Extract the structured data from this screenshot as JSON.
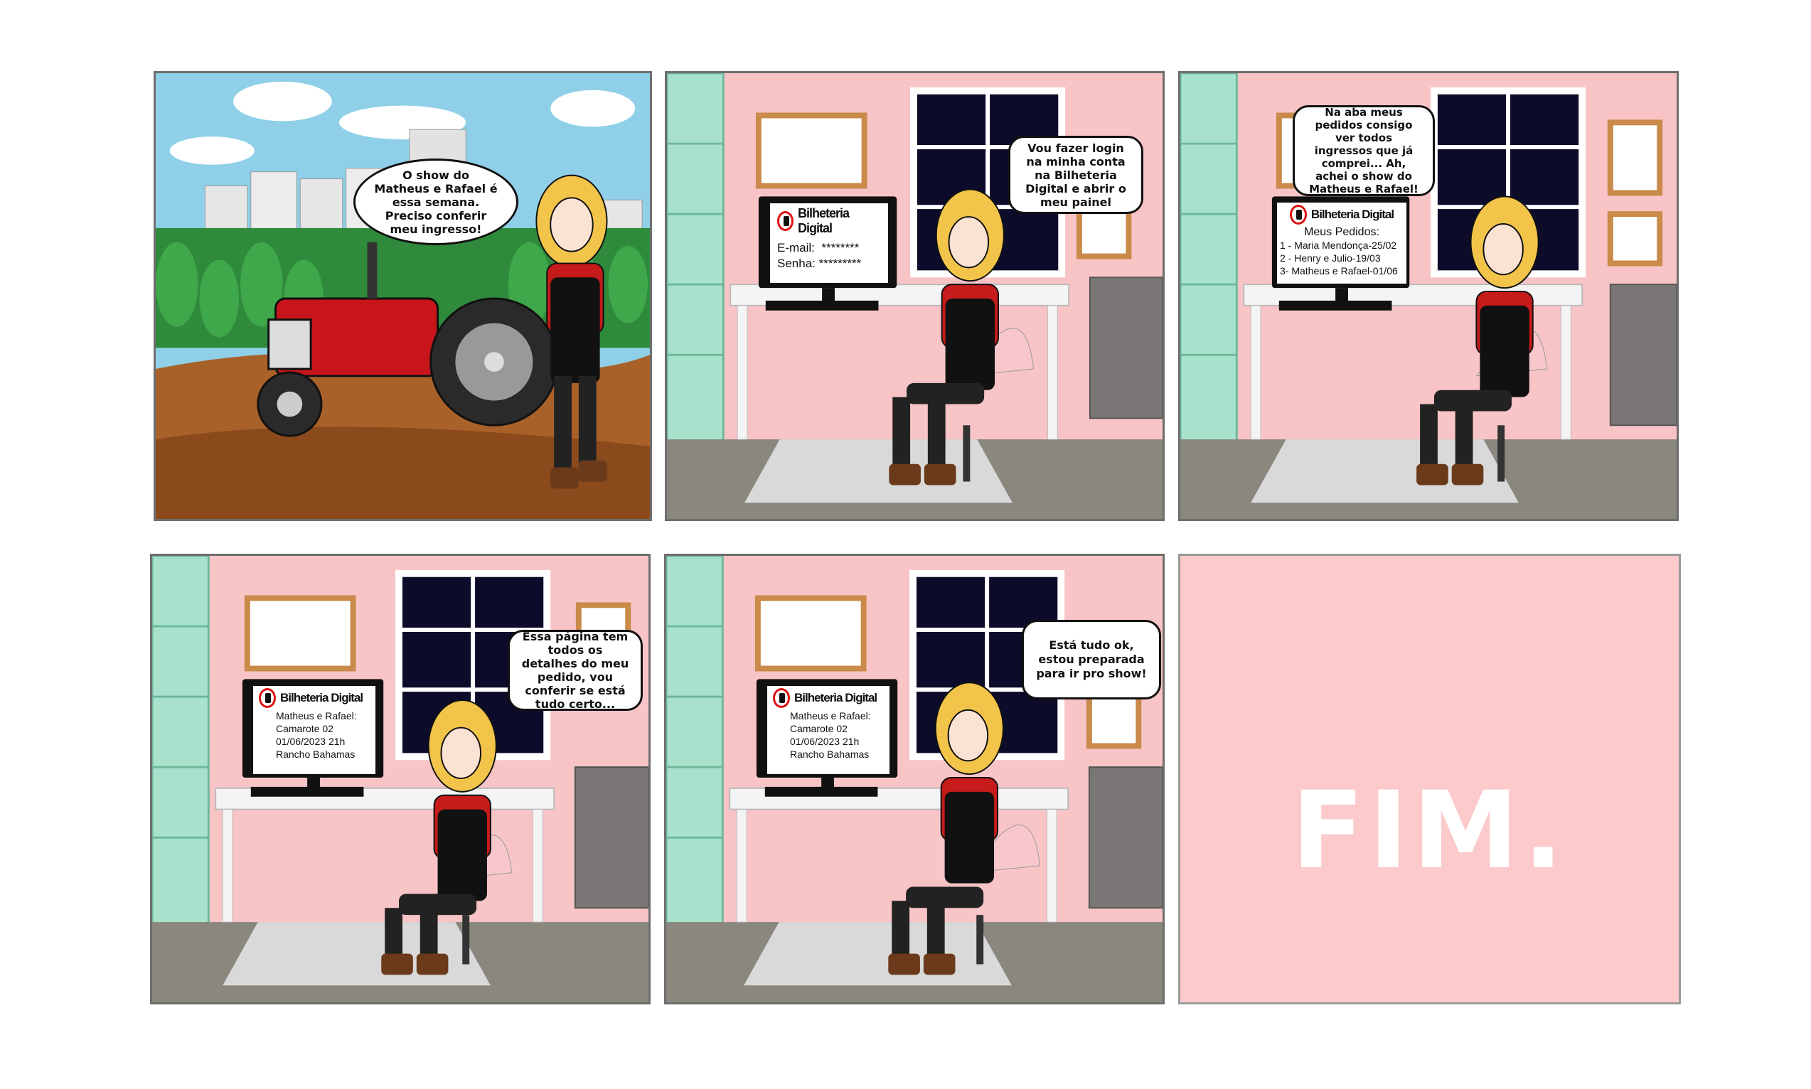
{
  "panels": [
    {
      "bubble": "O show do Matheus e Rafael é essa semana. Preciso conferir meu ingresso!"
    },
    {
      "bubble": "Vou fazer login na minha conta na Bilheteria Digital e abrir o meu painel",
      "screen": {
        "brand": "Bilheteria Digital",
        "email_label": "E-mail:",
        "email_value": "********",
        "password_label": "Senha:",
        "password_value": "*********"
      }
    },
    {
      "bubble": "Na aba meus pedidos consigo ver todos ingressos que já comprei... Ah, achei o show do Matheus e Rafael!",
      "screen": {
        "brand": "Bilheteria Digital",
        "heading": "Meus Pedidos:",
        "orders": [
          "1 - Maria Mendonça-25/02",
          "2 - Henry e Julio-19/03",
          "3- Matheus e Rafael-01/06"
        ]
      }
    },
    {
      "bubble": "Essa página tem todos os detalhes do meu pedido, vou conferir se está tudo certo...",
      "screen": {
        "brand": "Bilheteria Digital",
        "details": [
          "Matheus e Rafael:",
          "Camarote 02",
          "01/06/2023 21h",
          "Rancho Bahamas"
        ]
      }
    },
    {
      "bubble": "Está tudo ok, estou preparada para ir pro show!",
      "screen": {
        "brand": "Bilheteria Digital",
        "details": [
          "Matheus e Rafael:",
          "Camarote 02",
          "01/06/2023 21h",
          "Rancho Bahamas"
        ]
      }
    },
    {
      "text": "FIM."
    }
  ],
  "colors": {
    "wall_pink": "#f8c4c6",
    "shelf_mint": "#a8e2cc",
    "floor_gray": "#8a877f",
    "desk_white": "#f4f4f4",
    "sky_blue": "#8fd0e8",
    "soil_brown": "#a9612a",
    "tractor_red": "#c8151b",
    "shirt_red": "#c51b1b",
    "hair_blonde": "#f2c54a",
    "end_pink": "#fccacb"
  }
}
